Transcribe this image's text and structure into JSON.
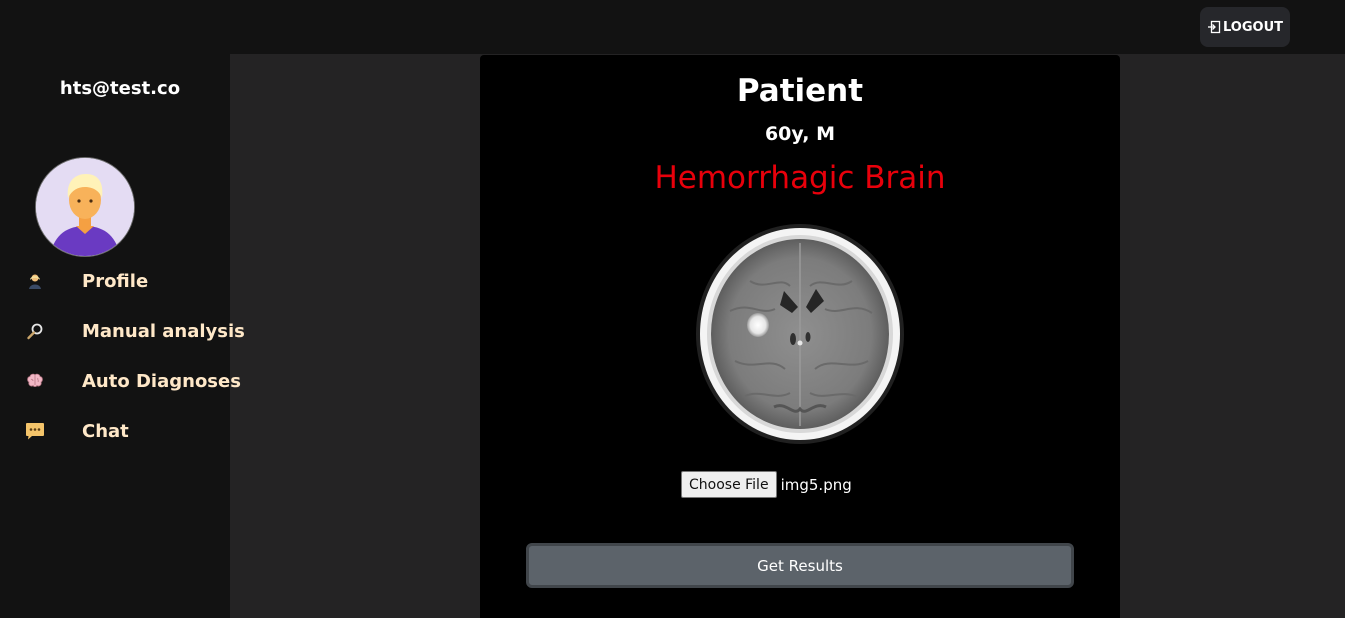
{
  "header": {
    "logout_label": "LOGOUT",
    "logout_icon": "logout-icon"
  },
  "sidebar": {
    "user_email": "hts@test.co",
    "avatar_icon": "user-avatar",
    "items": [
      {
        "label": "Profile",
        "icon": "person-icon"
      },
      {
        "label": "Manual analysis",
        "icon": "magnifier-icon"
      },
      {
        "label": "Auto Diagnoses",
        "icon": "brain-icon"
      },
      {
        "label": "Chat",
        "icon": "chat-icon"
      }
    ]
  },
  "main": {
    "title": "Patient",
    "patient_info": "60y, M",
    "diagnosis": "Hemorrhagic Brain",
    "diagnosis_color": "#e8000b",
    "scan_image": "brain-ct-scan",
    "file_input": {
      "button_label": "Choose File",
      "file_name": "img5.png"
    },
    "results_button": "Get Results"
  },
  "colors": {
    "topbar": "#121212",
    "sidebar": "#121212",
    "content_background": "#242324",
    "panel": "#000000",
    "nav_text": "#ffe8c8",
    "results_button": "#5c636a"
  }
}
